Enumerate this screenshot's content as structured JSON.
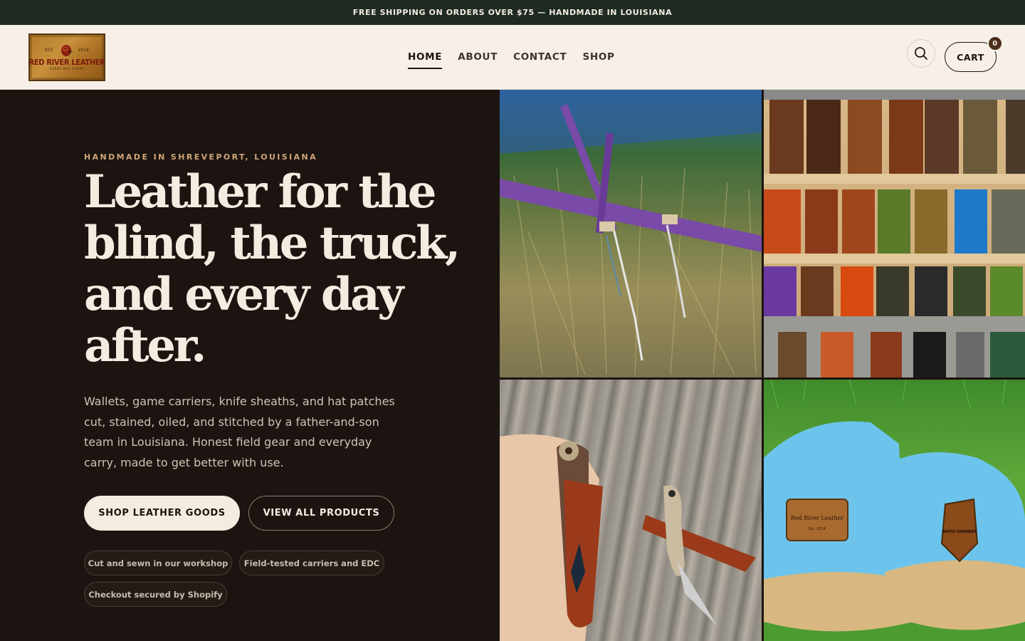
{
  "announcement": "FREE SHIPPING ON ORDERS OVER $75  —  HANDMADE IN LOUISIANA",
  "logo": {
    "est": "EST.",
    "year": "2014",
    "name": "RED RIVER LEATHER",
    "tagline": "EVERY DAY CARRY"
  },
  "nav": {
    "items": [
      {
        "label": "HOME",
        "active": true
      },
      {
        "label": "ABOUT",
        "active": false
      },
      {
        "label": "CONTACT",
        "active": false
      },
      {
        "label": "SHOP",
        "active": false
      }
    ]
  },
  "header": {
    "search_icon": "search-icon",
    "cart_label": "CART",
    "cart_count": "0"
  },
  "hero": {
    "eyebrow": "HANDMADE IN SHREVEPORT, LOUISIANA",
    "headline": "Leather for the blind, the truck, and every day after.",
    "subtext": "Wallets, game carriers, knife sheaths, and hat patches cut, stained, oiled, and stitched by a father-and-son team in Louisiana. Honest field gear and everyday carry, made to get better with use.",
    "primary_cta": "SHOP LEATHER GOODS",
    "secondary_cta": "VIEW ALL PRODUCTS",
    "pills": [
      "Cut and sewn in our workshop",
      "Field-tested carriers and EDC",
      "Checkout secured by Shopify"
    ]
  },
  "gallery": {
    "hat_patch_text": "Red River Leather",
    "hat_patch_year": "Est. 2014",
    "hat_patch_right": "BAYOU GUNNERS"
  },
  "colors": {
    "announcement_bg": "#1e2a22",
    "header_bg": "#f6f0e8",
    "hero_bg": "#1b1410",
    "accent": "#cfa57a",
    "headline": "#f4ece0"
  }
}
